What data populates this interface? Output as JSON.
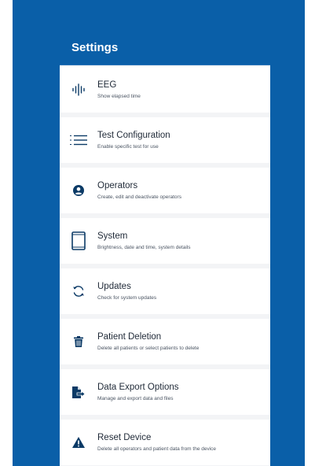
{
  "header": {
    "title": "Settings"
  },
  "colors": {
    "brand": "#0a5fa8",
    "icon": "#0b3a66"
  },
  "items": [
    {
      "label": "EEG",
      "desc": "Show elapsed time",
      "icon": "waveform-icon"
    },
    {
      "label": "Test  Configuration",
      "desc": "Enable specific test for use",
      "icon": "list-icon"
    },
    {
      "label": "Operators",
      "desc": "Create, edit and deactivate operators",
      "icon": "user-circle-icon"
    },
    {
      "label": "System",
      "desc": "Brightness, date and time, system details",
      "icon": "tablet-icon"
    },
    {
      "label": "Updates",
      "desc": "Check for system updates",
      "icon": "refresh-icon"
    },
    {
      "label": "Patient Deletion",
      "desc": "Delete all patients or select patients to delete",
      "icon": "trash-icon"
    },
    {
      "label": "Data Export Options",
      "desc": "Manage and export data and files",
      "icon": "file-export-icon"
    },
    {
      "label": "Reset Device",
      "desc": "Delete all operators and patient data from the device",
      "icon": "warning-icon"
    }
  ]
}
